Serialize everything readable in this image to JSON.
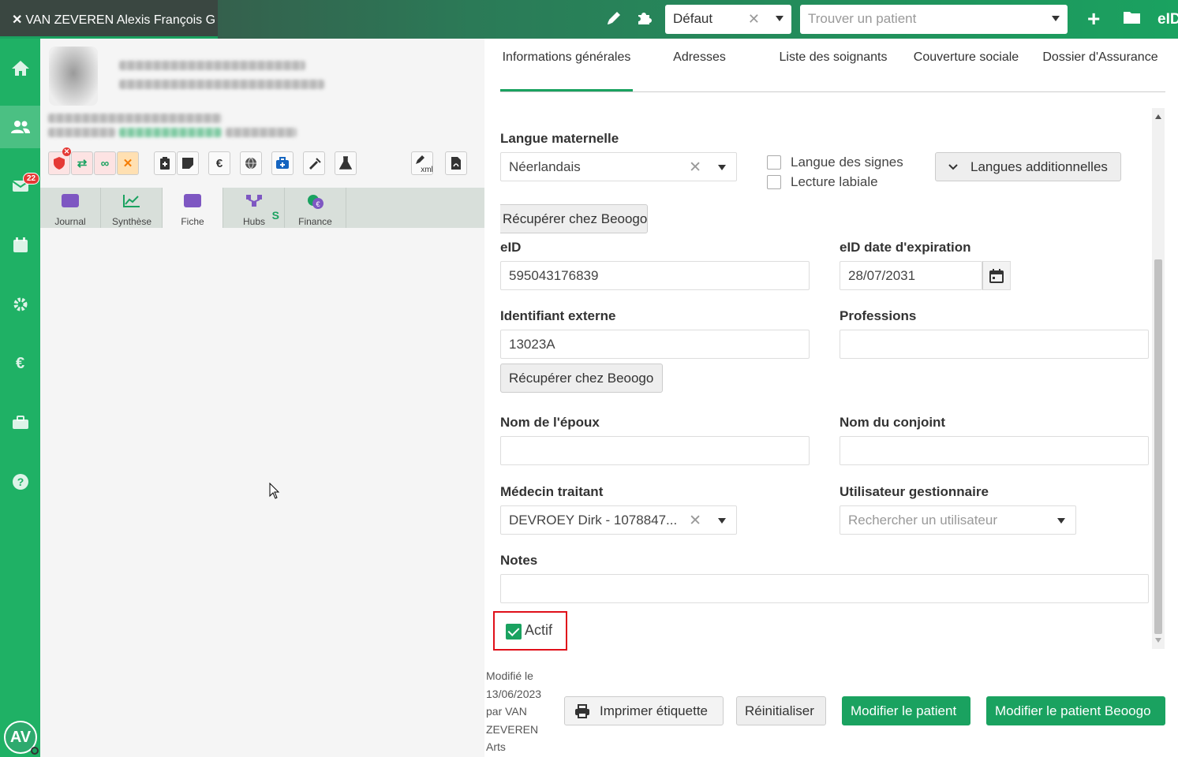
{
  "topbar": {
    "patient_tab": "VAN ZEVEREN Alexis François G",
    "close_glyph": "✕",
    "profile_select": "Défaut",
    "patient_search_placeholder": "Trouver un patient",
    "eid_label": "eID",
    "icons": [
      "pencil-icon",
      "puzzle-icon",
      "plus-icon",
      "folder-icon"
    ]
  },
  "leftnav": {
    "items": [
      "home-icon",
      "patients-icon",
      "mail-icon",
      "calendar-icon",
      "settings-icon",
      "euro-icon",
      "toolbox-icon",
      "help-icon"
    ],
    "mail_badge": "22",
    "avatar": "AV"
  },
  "leftpanel": {
    "tools": [
      "€",
      "xml"
    ],
    "tabs": [
      {
        "label": "Journal",
        "color": "#7e57c2"
      },
      {
        "label": "Synthèse",
        "color": "#1aa260"
      },
      {
        "label": "Fiche",
        "color": "#7e57c2"
      },
      {
        "label": "Hubs",
        "color": "#7e57c2",
        "badge": "S"
      },
      {
        "label": "Finance",
        "color": "#1aa260"
      }
    ]
  },
  "right": {
    "tabs": [
      "Informations générales",
      "Adresses",
      "Liste des soignants",
      "Couverture sociale",
      "Dossier d'Assurance"
    ],
    "langue_label": "Langue maternelle",
    "langue_value": "Néerlandais",
    "langue_signes": "Langue des signes",
    "lecture_labiale": "Lecture labiale",
    "langues_add_btn": "Langues additionnelles",
    "recuperer_btn_1": "Récupérer chez Beoogo",
    "eid_label": "eID",
    "eid_value": "595043176839",
    "eid_exp_label": "eID date d'expiration",
    "eid_exp_value": "28/07/2031",
    "ident_label": "Identifiant externe",
    "ident_value": "13023A",
    "prof_label": "Professions",
    "recuperer_btn_2": "Récupérer chez Beoogo",
    "epoux_label": "Nom de l'époux",
    "conjoint_label": "Nom du conjoint",
    "medecin_label": "Médecin traitant",
    "medecin_value": "DEVROEY Dirk - 1078847...",
    "gestionnaire_label": "Utilisateur gestionnaire",
    "gestionnaire_placeholder": "Rechercher un utilisateur",
    "notes_label": "Notes",
    "actif_label": "Actif",
    "modif_lines": [
      "Modifié le",
      "13/06/2023",
      "par VAN",
      "ZEVEREN",
      "Arts"
    ],
    "btn_print": "Imprimer étiquette",
    "btn_reset": "Réinitialiser",
    "btn_modify": "Modifier le patient",
    "btn_modify_beoogo": "Modifier le patient Beoogo"
  },
  "colors": {
    "accent": "#1aa260",
    "highlight": "#e0101a"
  }
}
